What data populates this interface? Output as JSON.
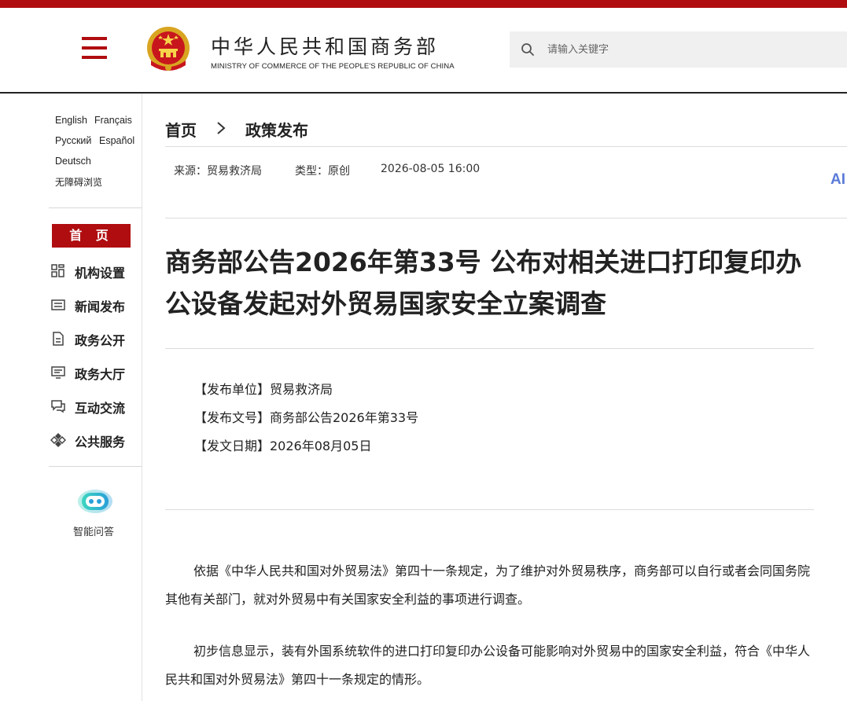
{
  "header": {
    "site_name": "中华人民共和国商务部",
    "site_name_en": "MINISTRY OF COMMERCE OF THE PEOPLE'S REPUBLIC OF CHINA",
    "search_placeholder": "请输入关键字",
    "brand_color": "#b00d10"
  },
  "sidebar": {
    "languages": [
      "English",
      "Français",
      "Русский",
      "Español",
      "Deutsch"
    ],
    "accessibility": "无障碍浏览",
    "home": "首 页",
    "nav": [
      {
        "label": "机构设置",
        "icon": "grid-icon"
      },
      {
        "label": "新闻发布",
        "icon": "news-icon"
      },
      {
        "label": "政务公开",
        "icon": "document-icon"
      },
      {
        "label": "政务大厅",
        "icon": "monitor-icon"
      },
      {
        "label": "互动交流",
        "icon": "chat-icon"
      },
      {
        "label": "公共服务",
        "icon": "service-icon"
      }
    ],
    "assistant": "智能问答"
  },
  "breadcrumb": {
    "home": "首页",
    "current": "政策发布"
  },
  "meta": {
    "source": "来源：贸易救济局",
    "type": "类型：原创",
    "datetime": "2026-08-05 16:00",
    "ai_tag": "AI"
  },
  "article": {
    "title": "商务部公告2026年第33号 公布对相关进口打印复印办公设备发起对外贸易国家安全立案调查",
    "info": [
      "【发布单位】贸易救济局",
      "【发布文号】商务部公告2026年第33号",
      "【发文日期】2026年08月05日"
    ],
    "paragraphs": [
      "依据《中华人民共和国对外贸易法》第四十一条规定，为了维护对外贸易秩序，商务部可以自行或者会同国务院其他有关部门，就对外贸易中有关国家安全利益的事项进行调查。",
      "初步信息显示，装有外国系统软件的进口打印复印办公设备可能影响对外贸易中的国家安全利益，符合《中华人民共和国对外贸易法》第四十一条规定的情形。"
    ]
  }
}
